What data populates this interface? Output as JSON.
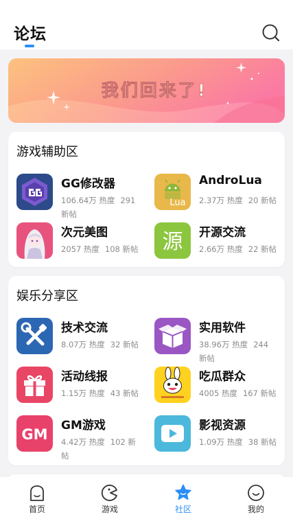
{
  "header": {
    "title": "论坛"
  },
  "banner": {
    "text": "我们回来了!"
  },
  "sections": [
    {
      "title": "游戏辅助区",
      "boards": [
        {
          "name": "GG修改器",
          "heat": "106.64万 热度",
          "posts": "291 新帖",
          "icon": "gg-modifier-icon"
        },
        {
          "name": "AndroLua",
          "heat": "2.37万 热度",
          "posts": "20 新帖",
          "icon": "androlua-icon"
        },
        {
          "name": "次元美图",
          "heat": "2057 热度",
          "posts": "108 新帖",
          "icon": "anime-girl-icon"
        },
        {
          "name": "开源交流",
          "heat": "2.66万 热度",
          "posts": "22 新帖",
          "icon": "open-source-icon"
        }
      ]
    },
    {
      "title": "娱乐分享区",
      "boards": [
        {
          "name": "技术交流",
          "heat": "8.07万 热度",
          "posts": "32 新帖",
          "icon": "tools-icon"
        },
        {
          "name": "实用软件",
          "heat": "38.96万 热度",
          "posts": "244 新帖",
          "icon": "box-icon"
        },
        {
          "name": "活动线报",
          "heat": "1.15万 热度",
          "posts": "43 新帖",
          "icon": "gift-icon"
        },
        {
          "name": "吃瓜群众",
          "heat": "4005 热度",
          "posts": "167 新帖",
          "icon": "rabbit-mascot-icon"
        },
        {
          "name": "GM游戏",
          "heat": "4.42万 热度",
          "posts": "102 新帖",
          "icon": "gm-icon"
        },
        {
          "name": "影视资源",
          "heat": "1.09万 热度",
          "posts": "38 新帖",
          "icon": "play-icon"
        }
      ]
    }
  ],
  "icon_texts": {
    "lua": "Lua",
    "yuan": "源",
    "gm": "GM"
  },
  "tabs": [
    {
      "label": "首页",
      "icon": "home-icon"
    },
    {
      "label": "游戏",
      "icon": "game-icon"
    },
    {
      "label": "社区",
      "icon": "community-star-icon",
      "active": true
    },
    {
      "label": "我的",
      "icon": "profile-icon"
    }
  ],
  "colors": {
    "accent": "#2b8ef5",
    "banner_start": "#fbc07d",
    "banner_end": "#fb7ea2"
  }
}
